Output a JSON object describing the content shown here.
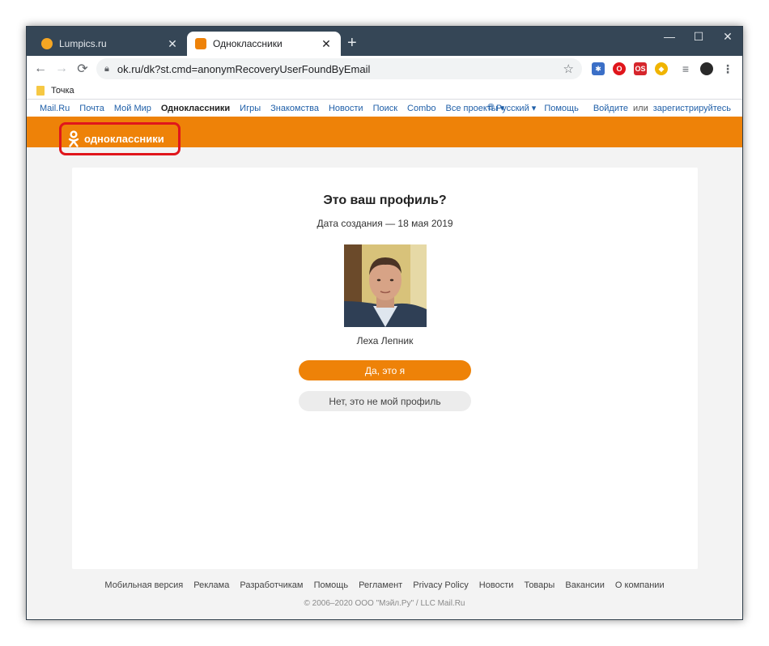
{
  "browser": {
    "tabs": [
      {
        "title": "Lumpics.ru",
        "active": false,
        "favicon_color": "#f5a623"
      },
      {
        "title": "Одноклассники",
        "active": true,
        "favicon_color": "#ee8208"
      }
    ],
    "new_tab_label": "+",
    "controls": {
      "minimize": "—",
      "maximize": "☐",
      "close": "✕"
    },
    "nav": {
      "back": "←",
      "forward": "→",
      "reload": "⟳"
    },
    "url": "ok.ru/dk?st.cmd=anonymRecoveryUserFoundByEmail",
    "bookmarks": [
      {
        "label": "Точка",
        "icon": "folder-icon"
      }
    ],
    "extensions": [
      {
        "name": "vpn-extension",
        "color": "#3b6fc7",
        "glyph": "✱"
      },
      {
        "name": "opera-extension",
        "color": "#e0161c",
        "glyph": "O"
      },
      {
        "name": "os-extension",
        "color": "#d6262c",
        "glyph": "OS"
      },
      {
        "name": "shield-extension",
        "color": "#f0b400",
        "glyph": "◆"
      },
      {
        "name": "playlist-extension",
        "color": "#5f6368",
        "glyph": "≡"
      }
    ]
  },
  "portal": {
    "links": [
      "Mail.Ru",
      "Почта",
      "Мой Мир",
      "Одноклассники",
      "Игры",
      "Знакомства",
      "Новости",
      "Поиск",
      "Combo",
      "Все проекты ▾"
    ],
    "current": "Одноклассники",
    "language": "Русский ▾",
    "help": "Помощь",
    "login": "Войдите",
    "or": "или",
    "register": "зарегистрируйтесь"
  },
  "header": {
    "logo_text": "одноклассники",
    "brand_color": "#ee8208",
    "highlight_color": "#e0161c"
  },
  "profile": {
    "question": "Это ваш профиль?",
    "created": "Дата создания — 18 мая 2019",
    "name": "Леха Лепник",
    "yes_button": "Да, это я",
    "no_button": "Нет, это не мой профиль"
  },
  "footer": {
    "links": [
      "Мобильная версия",
      "Реклама",
      "Разработчикам",
      "Помощь",
      "Регламент",
      "Privacy Policy",
      "Новости",
      "Товары",
      "Вакансии",
      "О компании"
    ],
    "copyright": "© 2006–2020 ООО \"Мэйл.Ру\" / LLC Mail.Ru"
  }
}
